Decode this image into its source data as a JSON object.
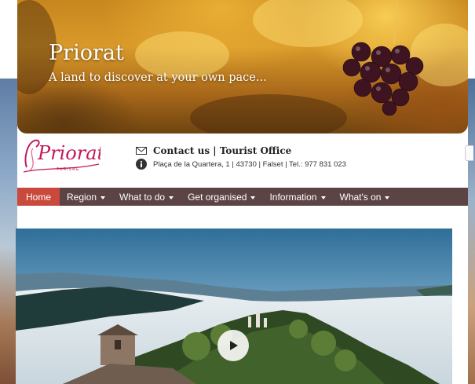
{
  "banner": {
    "title": "Priorat",
    "subtitle": "A land to discover at your own pace..."
  },
  "logo": {
    "text": "Priorat",
    "small_text": "TURISME"
  },
  "contact": {
    "icon": "envelope-icon",
    "title": "Contact us | Tourist Office",
    "address_icon": "info-icon",
    "address": "Plaça de la Quartera, 1 | 43730 | Falset | Tel.: 977 831 023"
  },
  "nav": {
    "items": [
      {
        "label": "Home",
        "active": true,
        "dropdown": false
      },
      {
        "label": "Region",
        "active": false,
        "dropdown": true
      },
      {
        "label": "What to do",
        "active": false,
        "dropdown": true
      },
      {
        "label": "Get organised",
        "active": false,
        "dropdown": true
      },
      {
        "label": "Information",
        "active": false,
        "dropdown": true
      },
      {
        "label": "What's on",
        "active": false,
        "dropdown": true
      }
    ]
  },
  "video": {
    "play_icon": "play-icon"
  },
  "colors": {
    "nav_background": "#5b4443",
    "nav_active": "#c94a3d",
    "logo_pink": "#c2185b"
  }
}
